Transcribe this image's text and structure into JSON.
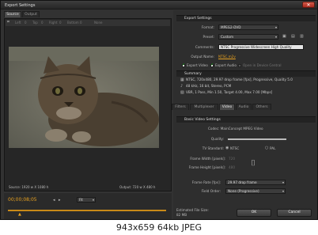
{
  "window": {
    "title": "Export Settings",
    "close_glyph": "✕"
  },
  "left": {
    "tabs": [
      "Source",
      "Output"
    ],
    "crop_toolbar": [
      "Left",
      "0",
      "Top",
      "0",
      "Right",
      "0",
      "Bottom",
      "0",
      "None"
    ],
    "source_info": "Source: 1920 w X 1080 h",
    "output_info": "Output: 720 w X 480 h",
    "timecode": "00;00;08;05",
    "fit_select": "Fit"
  },
  "export": {
    "header": "Export Settings",
    "format_label": "Format:",
    "format_value": "MPEG2-DVD",
    "preset_label": "Preset:",
    "preset_value": "Custom",
    "comments_label": "Comments:",
    "comments_value": "NTSC Progressive Widescreen High Quality",
    "output_name_label": "Output Name:",
    "output_name_value": "NTSC.m2v",
    "export_video": "Export Video",
    "export_audio": "Export Audio",
    "open_in_dc": "Open in Device Central"
  },
  "summary": {
    "header": "Summary",
    "lines": [
      "NTSC, 720x480, 29.97 drop frame [fps], Progressive, Quality 5.0",
      "48 kHz, 16 bit, Stereo, PCM",
      "VBR, 1 Pass, Min 1.50, Target 4.00, Max 7.00 [Mbps]"
    ]
  },
  "tabs": [
    "Filters",
    "Multiplexer",
    "Video",
    "Audio",
    "Others"
  ],
  "video": {
    "header": "Basic Video Settings",
    "codec": "Codec: MainConcept MPEG Video",
    "quality_label": "Quality:",
    "quality_fraction": 1.0,
    "tv_label": "TV Standard:",
    "ntsc": "NTSC",
    "pal": "PAL",
    "frame_width_label": "Frame Width [pixels]:",
    "frame_width": "720",
    "frame_height_label": "Frame Height [pixels]:",
    "frame_height": "480",
    "frame_rate_label": "Frame Rate [fps]:",
    "frame_rate": "29.97 drop frame",
    "field_order_label": "Field Order:",
    "field_order": "None (Progressive)"
  },
  "footer": {
    "estimated_label": "Estimated File Size:",
    "estimated_value": "82 MB",
    "ok": "OK",
    "cancel": "Cancel"
  },
  "caption": "943x659 64kb JPEG",
  "colors": {
    "accent": "#e6a020",
    "window_bg": "#323232",
    "panel_dark": "#262626"
  }
}
